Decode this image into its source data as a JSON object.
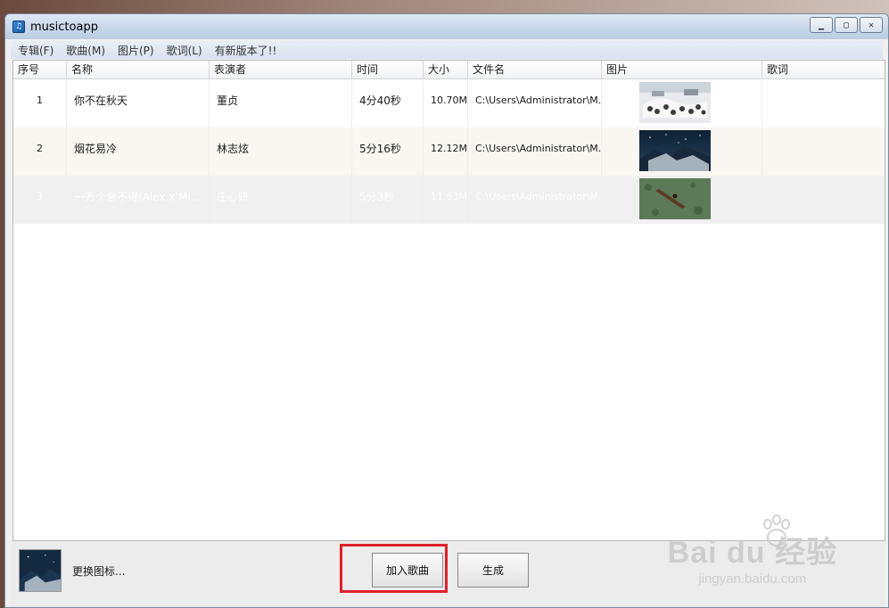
{
  "window": {
    "title": "musictoapp",
    "controls": [
      "minimize",
      "maximize",
      "close"
    ]
  },
  "menu": [
    {
      "label": "专辑(F)"
    },
    {
      "label": "歌曲(M)"
    },
    {
      "label": "图片(P)"
    },
    {
      "label": "歌词(L)"
    },
    {
      "label": "有新版本了!!"
    }
  ],
  "table": {
    "columns": [
      "序号",
      "名称",
      "表演者",
      "时间",
      "大小",
      "文件名",
      "图片",
      "歌词"
    ],
    "rows": [
      {
        "index": "1",
        "name": "你不在秋天",
        "artist": "董贞",
        "time": "4分40秒",
        "size": "10.70M",
        "file": "C:\\Users\\Administrator\\M...",
        "lyrics": "",
        "thumb": "snow-scene"
      },
      {
        "index": "2",
        "name": "烟花易冷",
        "artist": "林志炫",
        "time": "5分16秒",
        "size": "12.12M",
        "file": "C:\\Users\\Administrator\\M...",
        "lyrics": "",
        "thumb": "night-sky-mountain"
      },
      {
        "index": "3",
        "name": "一万个舍不得(Alex.x Mi...",
        "artist": "庄心妍",
        "time": "5分3秒",
        "size": "11.63M",
        "file": "C:\\Users\\Administrator\\M...",
        "lyrics": "",
        "thumb": "boat-on-water"
      }
    ]
  },
  "bottom": {
    "change_icon_label": "更换图标...",
    "add_song_label": "加入歌曲",
    "generate_label": "生成"
  },
  "watermark": {
    "logo": "Bai du 经验",
    "url": "jingyan.baidu.com"
  },
  "colors": {
    "highlight": "#e0202a",
    "title_bar": "#cbd9ea"
  }
}
